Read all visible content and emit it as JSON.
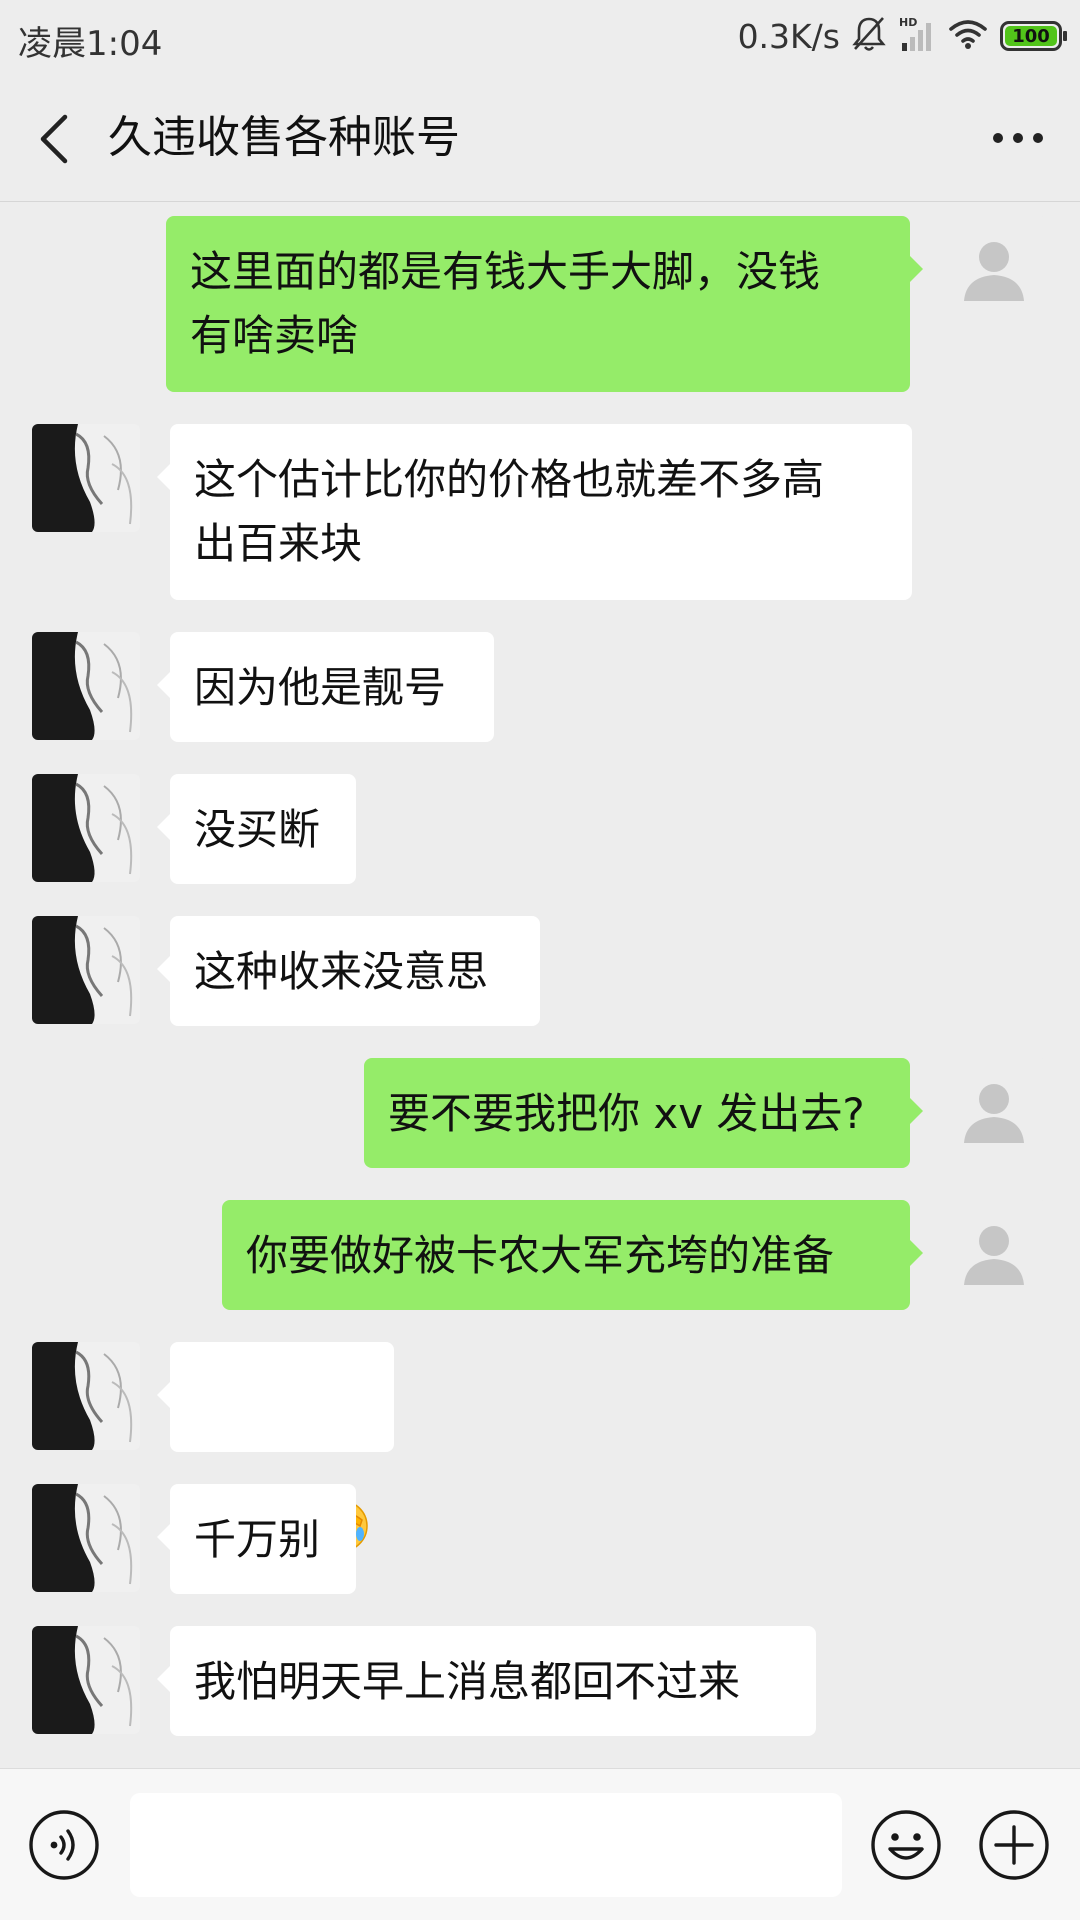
{
  "status_bar": {
    "time": "凌晨1:04",
    "net_speed": "0.3K/s",
    "network_badge": "HD",
    "battery": "100"
  },
  "header": {
    "title": "久违收售各种账号"
  },
  "messages": [
    {
      "side": "right",
      "text": "这里面的都是有钱大手大脚，没钱\n有啥卖啥"
    },
    {
      "side": "left",
      "text": "这个估计比你的价格也就差不多高\n出百来块"
    },
    {
      "side": "left",
      "text": "因为他是靓号"
    },
    {
      "side": "left",
      "text": "没买断"
    },
    {
      "side": "left",
      "text": "这种收来没意思"
    },
    {
      "side": "right",
      "text": "要不要我把你 xv 发出去?"
    },
    {
      "side": "right",
      "text": "你要做好被卡农大军充垮的准备"
    },
    {
      "side": "left",
      "emoji": [
        "facepalm-emoji",
        "facepalm-emoji",
        "facepalm-emoji"
      ]
    },
    {
      "side": "left",
      "text": "千万别"
    },
    {
      "side": "left",
      "text": "我怕明天早上消息都回不过来"
    }
  ],
  "input": {
    "value": "",
    "placeholder": ""
  },
  "colors": {
    "self_bubble": "#95ec69",
    "other_bubble": "#ffffff",
    "background": "#ededed"
  }
}
